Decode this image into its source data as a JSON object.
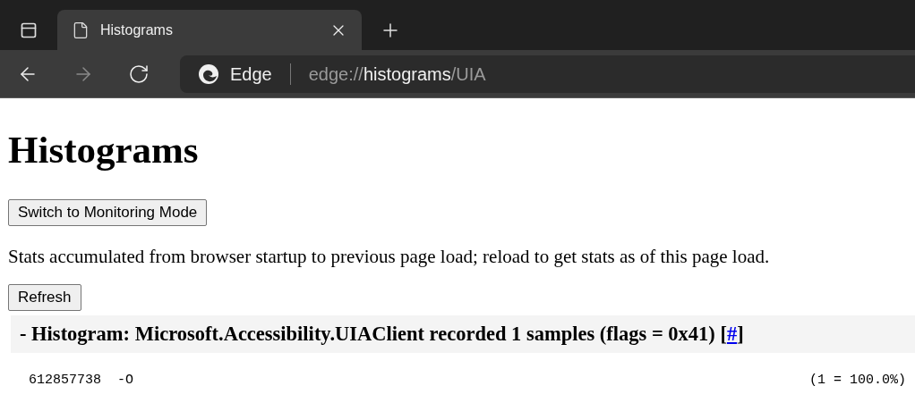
{
  "tab": {
    "title": "Histograms",
    "selected": true
  },
  "address_bar": {
    "site_label": "Edge",
    "scheme": "edge://",
    "host": "histograms",
    "path": "/UIA"
  },
  "page": {
    "title": "Histograms",
    "mode_button": "Switch to Monitoring Mode",
    "description": "Stats accumulated from browser startup to previous page load; reload to get stats as of this page load.",
    "refresh_button": "Refresh",
    "histogram": {
      "heading": "- Histogram: Microsoft.Accessibility.UIAClient recorded 1 samples (flags = 0x41) [",
      "link": "#",
      "heading_end": "]",
      "bucket": "612857738  -O",
      "count": "(1 = 100.0%)"
    }
  }
}
